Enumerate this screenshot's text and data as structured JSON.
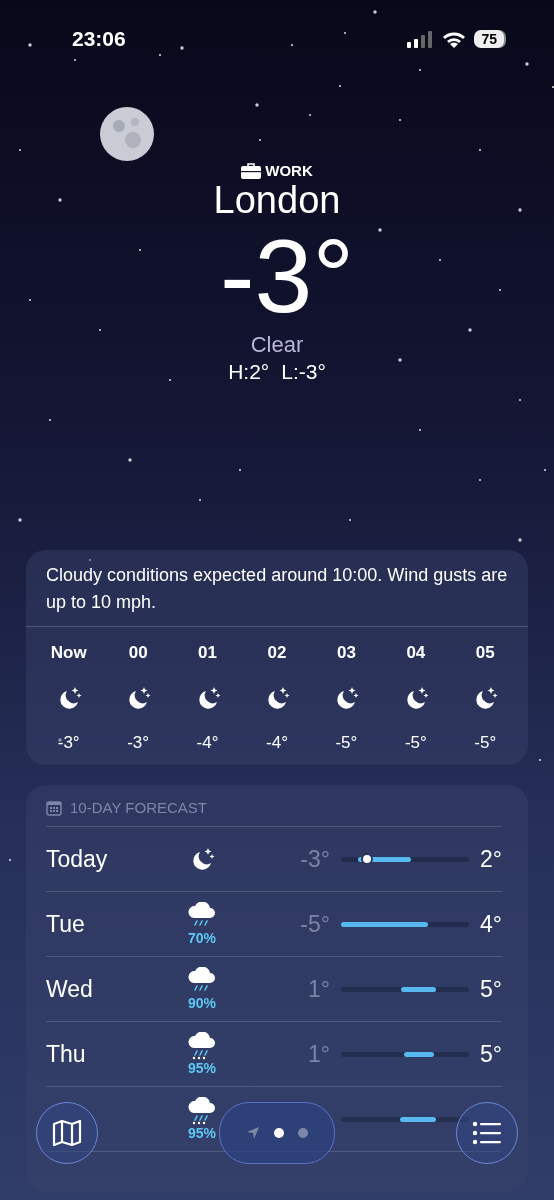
{
  "status_bar": {
    "time": "23:06",
    "battery": "75"
  },
  "location": {
    "label": "WORK",
    "city": "London",
    "temperature": "-3°",
    "condition": "Clear",
    "high": "H:2°",
    "low": "L:-3°"
  },
  "hourly": {
    "summary": "Cloudy conditions expected around 10:00. Wind gusts are up to 10 mph.",
    "hours": [
      {
        "time": "Now",
        "kind": "moon",
        "temp": "-3°"
      },
      {
        "time": "00",
        "kind": "moon",
        "temp": "-3°"
      },
      {
        "time": "01",
        "kind": "moon",
        "temp": "-4°"
      },
      {
        "time": "02",
        "kind": "moon",
        "temp": "-4°"
      },
      {
        "time": "03",
        "kind": "moon",
        "temp": "-5°"
      },
      {
        "time": "04",
        "kind": "moon",
        "temp": "-5°"
      },
      {
        "time": "05",
        "kind": "moon",
        "temp": "-5°"
      }
    ]
  },
  "forecast": {
    "title": "10-DAY FORECAST",
    "days": [
      {
        "day": "Today",
        "kind": "moon",
        "low": "-3°",
        "high": "2°"
      },
      {
        "day": "Tue",
        "kind": "rain",
        "precip": "70%",
        "low": "-5°",
        "high": "4°"
      },
      {
        "day": "Wed",
        "kind": "rain",
        "precip": "90%",
        "low": "1°",
        "high": "5°"
      },
      {
        "day": "Thu",
        "kind": "sleet",
        "precip": "95%",
        "low": "1°",
        "high": "5°"
      },
      {
        "kind": "sleet",
        "precip": "95%"
      }
    ]
  },
  "page_dots": [
    {
      "kind": "location",
      "selected": false
    },
    {
      "kind": "dot",
      "selected": true
    },
    {
      "kind": "dot",
      "selected": false
    }
  ]
}
